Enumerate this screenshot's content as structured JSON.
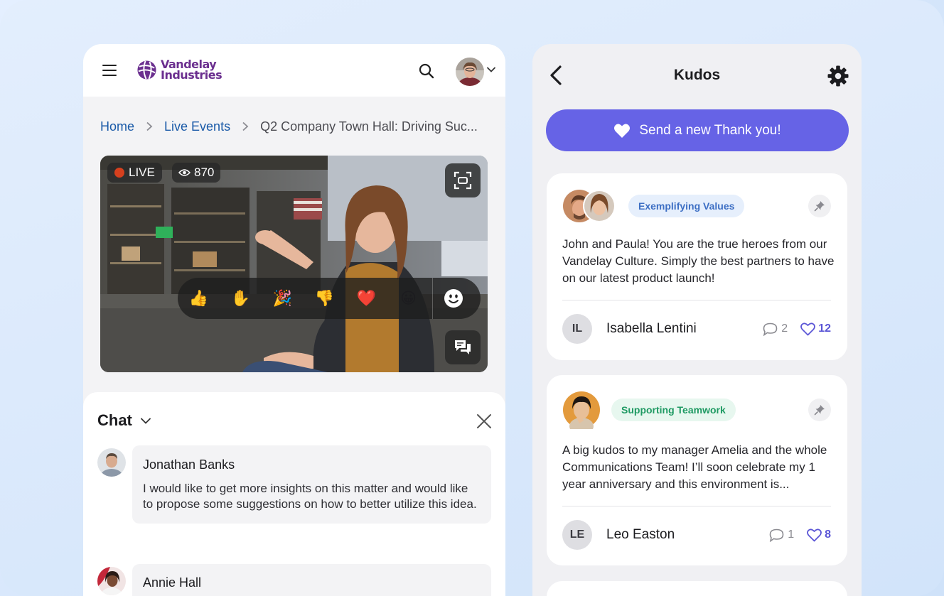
{
  "header": {
    "logo_line1": "Vandelay",
    "logo_line2": "Industries"
  },
  "breadcrumb": {
    "home": "Home",
    "live_events": "Live Events",
    "current": "Q2 Company Town Hall: Driving Suc..."
  },
  "video": {
    "live_label": "LIVE",
    "viewer_count": "870",
    "reactions": [
      "👍",
      "✋",
      "🎉",
      "👎",
      "❤️",
      "😀"
    ]
  },
  "chat": {
    "title": "Chat",
    "messages": [
      {
        "author": "Jonathan Banks",
        "text": "I would like to get more insights on this matter and would like to propose some suggestions on how to better utilize this idea."
      },
      {
        "author": "Annie Hall",
        "text": ""
      }
    ]
  },
  "kudos": {
    "title": "Kudos",
    "send_label": "Send a new Thank you!",
    "cards": [
      {
        "tag": "Exemplifying Values",
        "tag_color": "#3d6fc4",
        "tag_bg": "#e6effc",
        "text": "John and Paula! You are the true heroes from our Vandelay Culture. Simply the best partners to have on our latest product launch!",
        "initials": "IL",
        "author": "Isabella Lentini",
        "comments": "2",
        "likes": "12"
      },
      {
        "tag": "Supporting Teamwork",
        "tag_color": "#1f9a63",
        "tag_bg": "#e7f7ef",
        "text": "A big kudos to my manager Amelia and the whole Communications Team! I’ll soon celebrate my 1 year anniversary and this environment is...",
        "initials": "LE",
        "author": "Leo Easton",
        "comments": "1",
        "likes": "8"
      }
    ]
  },
  "colors": {
    "accent": "#6663e6",
    "link": "#1a5aa8",
    "brand": "#6b2f8f",
    "live": "#d6401e"
  }
}
